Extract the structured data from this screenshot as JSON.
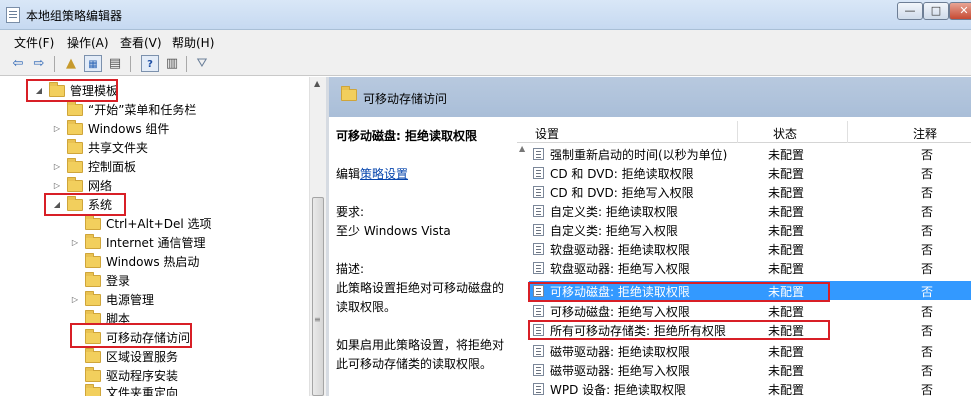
{
  "window": {
    "title": "本地组策略编辑器",
    "min": "—",
    "max": "□",
    "close": "✕"
  },
  "menu": [
    "文件(F)",
    "操作(A)",
    "查看(V)",
    "帮助(H)"
  ],
  "tree": [
    {
      "label": "管理模板",
      "twisty": "◢",
      "highlight": true
    },
    {
      "label": "“开始”菜单和任务栏",
      "twisty": ""
    },
    {
      "label": "Windows 组件",
      "twisty": "▷"
    },
    {
      "label": "共享文件夹",
      "twisty": ""
    },
    {
      "label": "控制面板",
      "twisty": "▷"
    },
    {
      "label": "网络",
      "twisty": "▷"
    },
    {
      "label": "系统",
      "twisty": "◢",
      "highlight": true
    },
    {
      "label": "Ctrl+Alt+Del 选项",
      "twisty": ""
    },
    {
      "label": "Internet 通信管理",
      "twisty": "▷"
    },
    {
      "label": "Windows 热启动",
      "twisty": ""
    },
    {
      "label": "登录",
      "twisty": ""
    },
    {
      "label": "电源管理",
      "twisty": "▷"
    },
    {
      "label": "脚本",
      "twisty": ""
    },
    {
      "label": "可移动存储访问",
      "twisty": "",
      "highlight": true
    },
    {
      "label": "区域设置服务",
      "twisty": ""
    },
    {
      "label": "驱动程序安装",
      "twisty": ""
    },
    {
      "label": "文件夹重定向",
      "twisty": ""
    }
  ],
  "right": {
    "title": "可移动存储访问",
    "desc": {
      "heading": "可移动磁盘: 拒绝读取权限",
      "edit_prefix": "编辑",
      "edit_link": "策略设置",
      "req_label": "要求:",
      "req_value": "至少 Windows Vista",
      "desc_label": "描述:",
      "desc_text": "此策略设置拒绝对可移动磁盘的读取权限。",
      "if_text": "如果启用此策略设置，将拒绝对此可移动存储类的读取权限。"
    },
    "columns": {
      "setting": "设置",
      "state": "状态",
      "note": "注释"
    },
    "rows": [
      {
        "name": "强制重新启动的时间(以秒为单位)",
        "state": "未配置",
        "note": "否"
      },
      {
        "name": "CD 和 DVD: 拒绝读取权限",
        "state": "未配置",
        "note": "否"
      },
      {
        "name": "CD 和 DVD: 拒绝写入权限",
        "state": "未配置",
        "note": "否"
      },
      {
        "name": "自定义类: 拒绝读取权限",
        "state": "未配置",
        "note": "否"
      },
      {
        "name": "自定义类: 拒绝写入权限",
        "state": "未配置",
        "note": "否"
      },
      {
        "name": "软盘驱动器: 拒绝读取权限",
        "state": "未配置",
        "note": "否"
      },
      {
        "name": "软盘驱动器: 拒绝写入权限",
        "state": "未配置",
        "note": "否"
      },
      {
        "name": "可移动磁盘: 拒绝读取权限",
        "state": "未配置",
        "note": "否",
        "selected": true
      },
      {
        "name": "可移动磁盘: 拒绝写入权限",
        "state": "未配置",
        "note": "否"
      },
      {
        "name": "所有可移动存储类: 拒绝所有权限",
        "state": "未配置",
        "note": "否"
      },
      {
        "name": "磁带驱动器: 拒绝读取权限",
        "state": "未配置",
        "note": "否"
      },
      {
        "name": "磁带驱动器: 拒绝写入权限",
        "state": "未配置",
        "note": "否"
      },
      {
        "name": "WPD 设备: 拒绝读取权限",
        "state": "未配置",
        "note": "否"
      }
    ]
  },
  "colors": {
    "highlight_box": "#d81f26",
    "selection": "#3399ff"
  }
}
